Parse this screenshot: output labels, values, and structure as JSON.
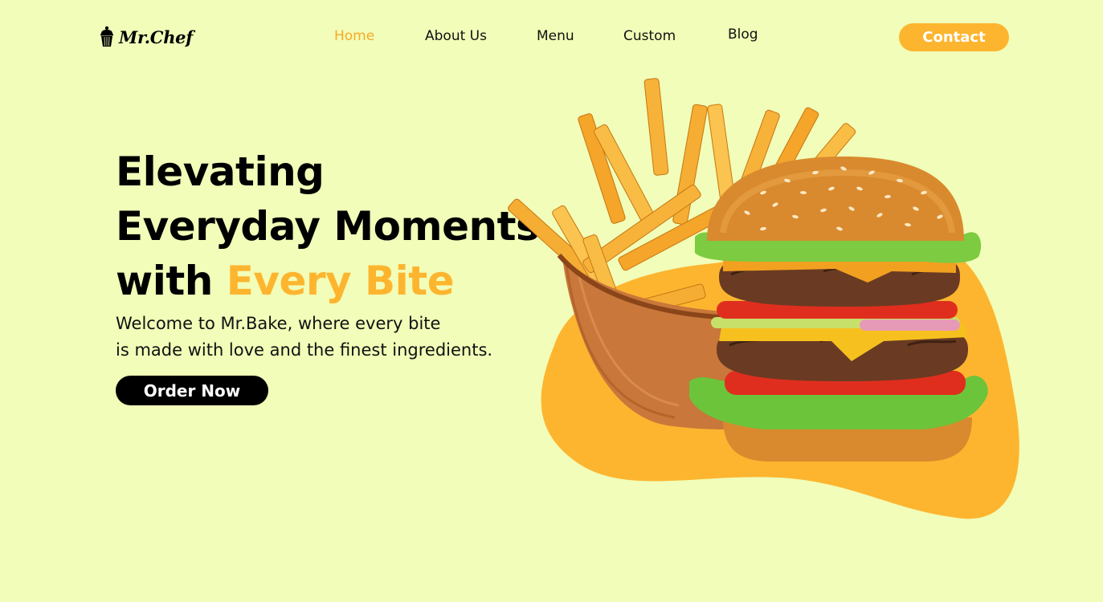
{
  "brand": {
    "name": "Mr.Chef",
    "icon": "cupcake-icon"
  },
  "nav": {
    "items": [
      {
        "label": "Home",
        "active": true
      },
      {
        "label": "About Us",
        "active": false
      },
      {
        "label": "Menu",
        "active": false
      },
      {
        "label": "Custom",
        "active": false
      },
      {
        "label": "Blog",
        "active": false
      }
    ],
    "contact_label": "Contact"
  },
  "hero": {
    "title_line1": "Elevating",
    "title_line2": "Everyday Moments",
    "title_line3_prefix": "with ",
    "title_line3_accent": "Every Bite",
    "subtitle_line1": "Welcome to Mr.Bake, where every bite",
    "subtitle_line2": "is made with love and the finest ingredients.",
    "cta_label": "Order Now",
    "image": "burger-and-fries-illustration"
  },
  "colors": {
    "background": "#f1fdb8",
    "accent": "#fdb52f",
    "text": "#000000"
  }
}
